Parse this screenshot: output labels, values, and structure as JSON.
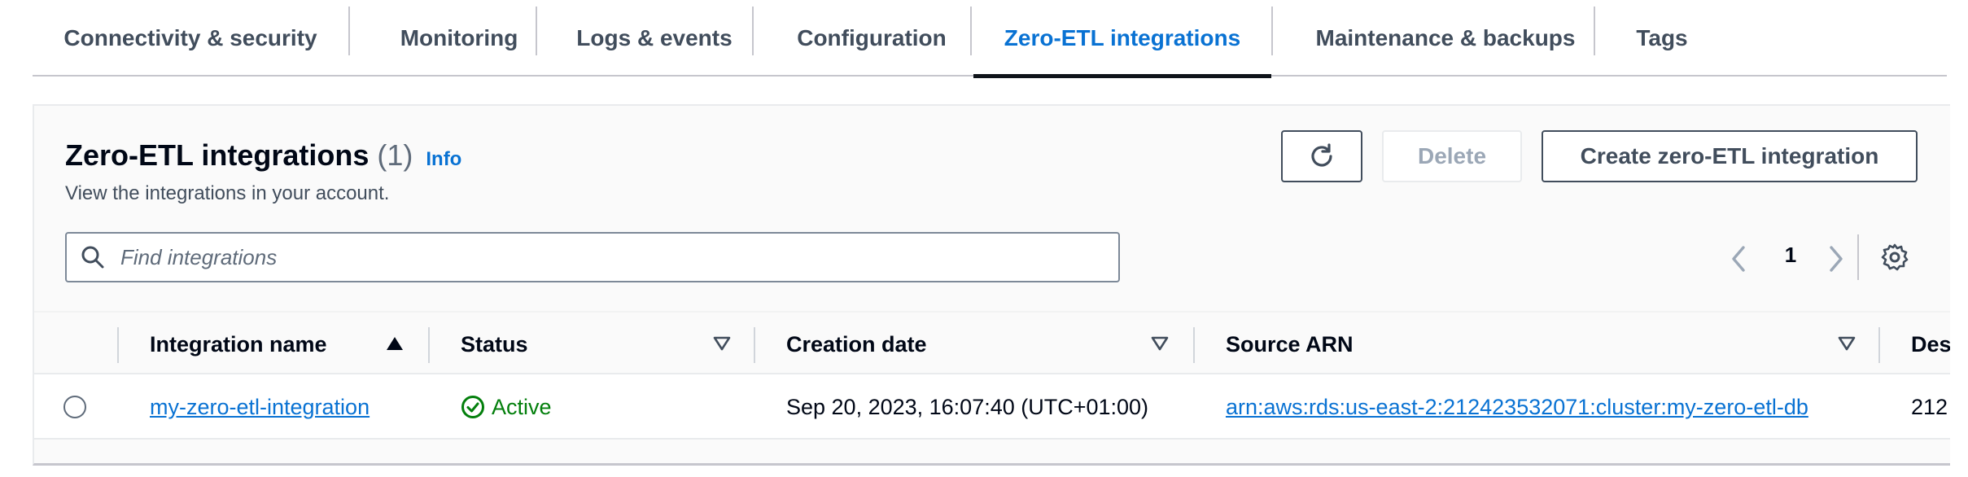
{
  "tabs": [
    {
      "label": "Connectivity & security"
    },
    {
      "label": "Monitoring"
    },
    {
      "label": "Logs & events"
    },
    {
      "label": "Configuration"
    },
    {
      "label": "Zero-ETL integrations",
      "active": true
    },
    {
      "label": "Maintenance & backups"
    },
    {
      "label": "Tags"
    }
  ],
  "panel": {
    "title": "Zero-ETL integrations",
    "count": "(1)",
    "info": "Info",
    "description": "View the integrations in your account.",
    "refresh_icon": "refresh-icon",
    "delete_label": "Delete",
    "create_label": "Create zero-ETL integration",
    "search_placeholder": "Find integrations",
    "page": "1"
  },
  "table": {
    "columns": [
      "Integration name",
      "Status",
      "Creation date",
      "Source ARN",
      "Des"
    ],
    "rows": [
      {
        "name": "my-zero-etl-integration",
        "status": "Active",
        "created": "Sep 20, 2023, 16:07:40 (UTC+01:00)",
        "source_arn": "arn:aws:rds:us-east-2:212423532071:cluster:my-zero-etl-db",
        "destination": "212"
      }
    ]
  },
  "colors": {
    "accent": "#0972d3",
    "success": "#037f0c",
    "text": "#000716"
  }
}
